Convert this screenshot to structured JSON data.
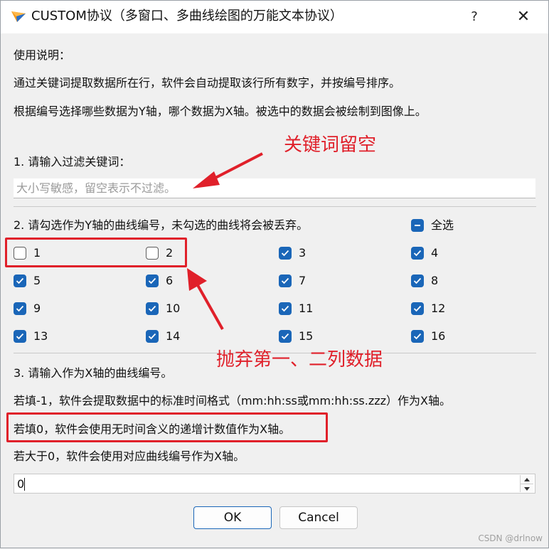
{
  "window": {
    "title": "CUSTOM协议（多窗口、多曲线绘图的万能文本协议）",
    "help": "?",
    "close": "✕"
  },
  "instructions": {
    "heading": "使用说明：",
    "line1": "通过关键词提取数据所在行，软件会自动提取该行所有数字，并按编号排序。",
    "line2": "根据编号选择哪些数据为Y轴，哪个数据为X轴。被选中的数据会被绘制到图像上。"
  },
  "step1": {
    "label": "1. 请输入过滤关键词：",
    "value": "",
    "placeholder": "大小写敏感，留空表示不过滤。"
  },
  "step2": {
    "label": "2. 请勾选作为Y轴的曲线编号，未勾选的曲线将会被丢弃。",
    "select_all_label": "全选",
    "select_all_state": "partial",
    "items": [
      {
        "label": "1",
        "checked": false
      },
      {
        "label": "2",
        "checked": false
      },
      {
        "label": "3",
        "checked": true
      },
      {
        "label": "4",
        "checked": true
      },
      {
        "label": "5",
        "checked": true
      },
      {
        "label": "6",
        "checked": true
      },
      {
        "label": "7",
        "checked": true
      },
      {
        "label": "8",
        "checked": true
      },
      {
        "label": "9",
        "checked": true
      },
      {
        "label": "10",
        "checked": true
      },
      {
        "label": "11",
        "checked": true
      },
      {
        "label": "12",
        "checked": true
      },
      {
        "label": "13",
        "checked": true
      },
      {
        "label": "14",
        "checked": true
      },
      {
        "label": "15",
        "checked": true
      },
      {
        "label": "16",
        "checked": true
      }
    ]
  },
  "step3": {
    "label": "3. 请输入作为X轴的曲线编号。",
    "note1": "若填-1，软件会提取数据中的标准时间格式（mm:hh:ss或mm:hh:ss.zzz）作为X轴。",
    "note2": "若填0，软件会使用无时间含义的递增计数值作为X轴。",
    "note3": "若大于0，软件会使用对应曲线编号作为X轴。",
    "value": "0"
  },
  "buttons": {
    "ok": "OK",
    "cancel": "Cancel"
  },
  "annotations": {
    "keyword_empty": "关键词留空",
    "discard_columns": "抛弃第一、二列数据"
  },
  "watermark": "CSDN @drlnow",
  "colors": {
    "accent": "#1a66b8",
    "annotation_red": "#e0202a",
    "background": "#f0f0f0"
  },
  "icons": {
    "app": "paper-plane-icon",
    "help": "question-mark-icon",
    "close": "close-icon",
    "spin_up": "chevron-up-icon",
    "spin_down": "chevron-down-icon",
    "check": "checkmark-icon"
  }
}
